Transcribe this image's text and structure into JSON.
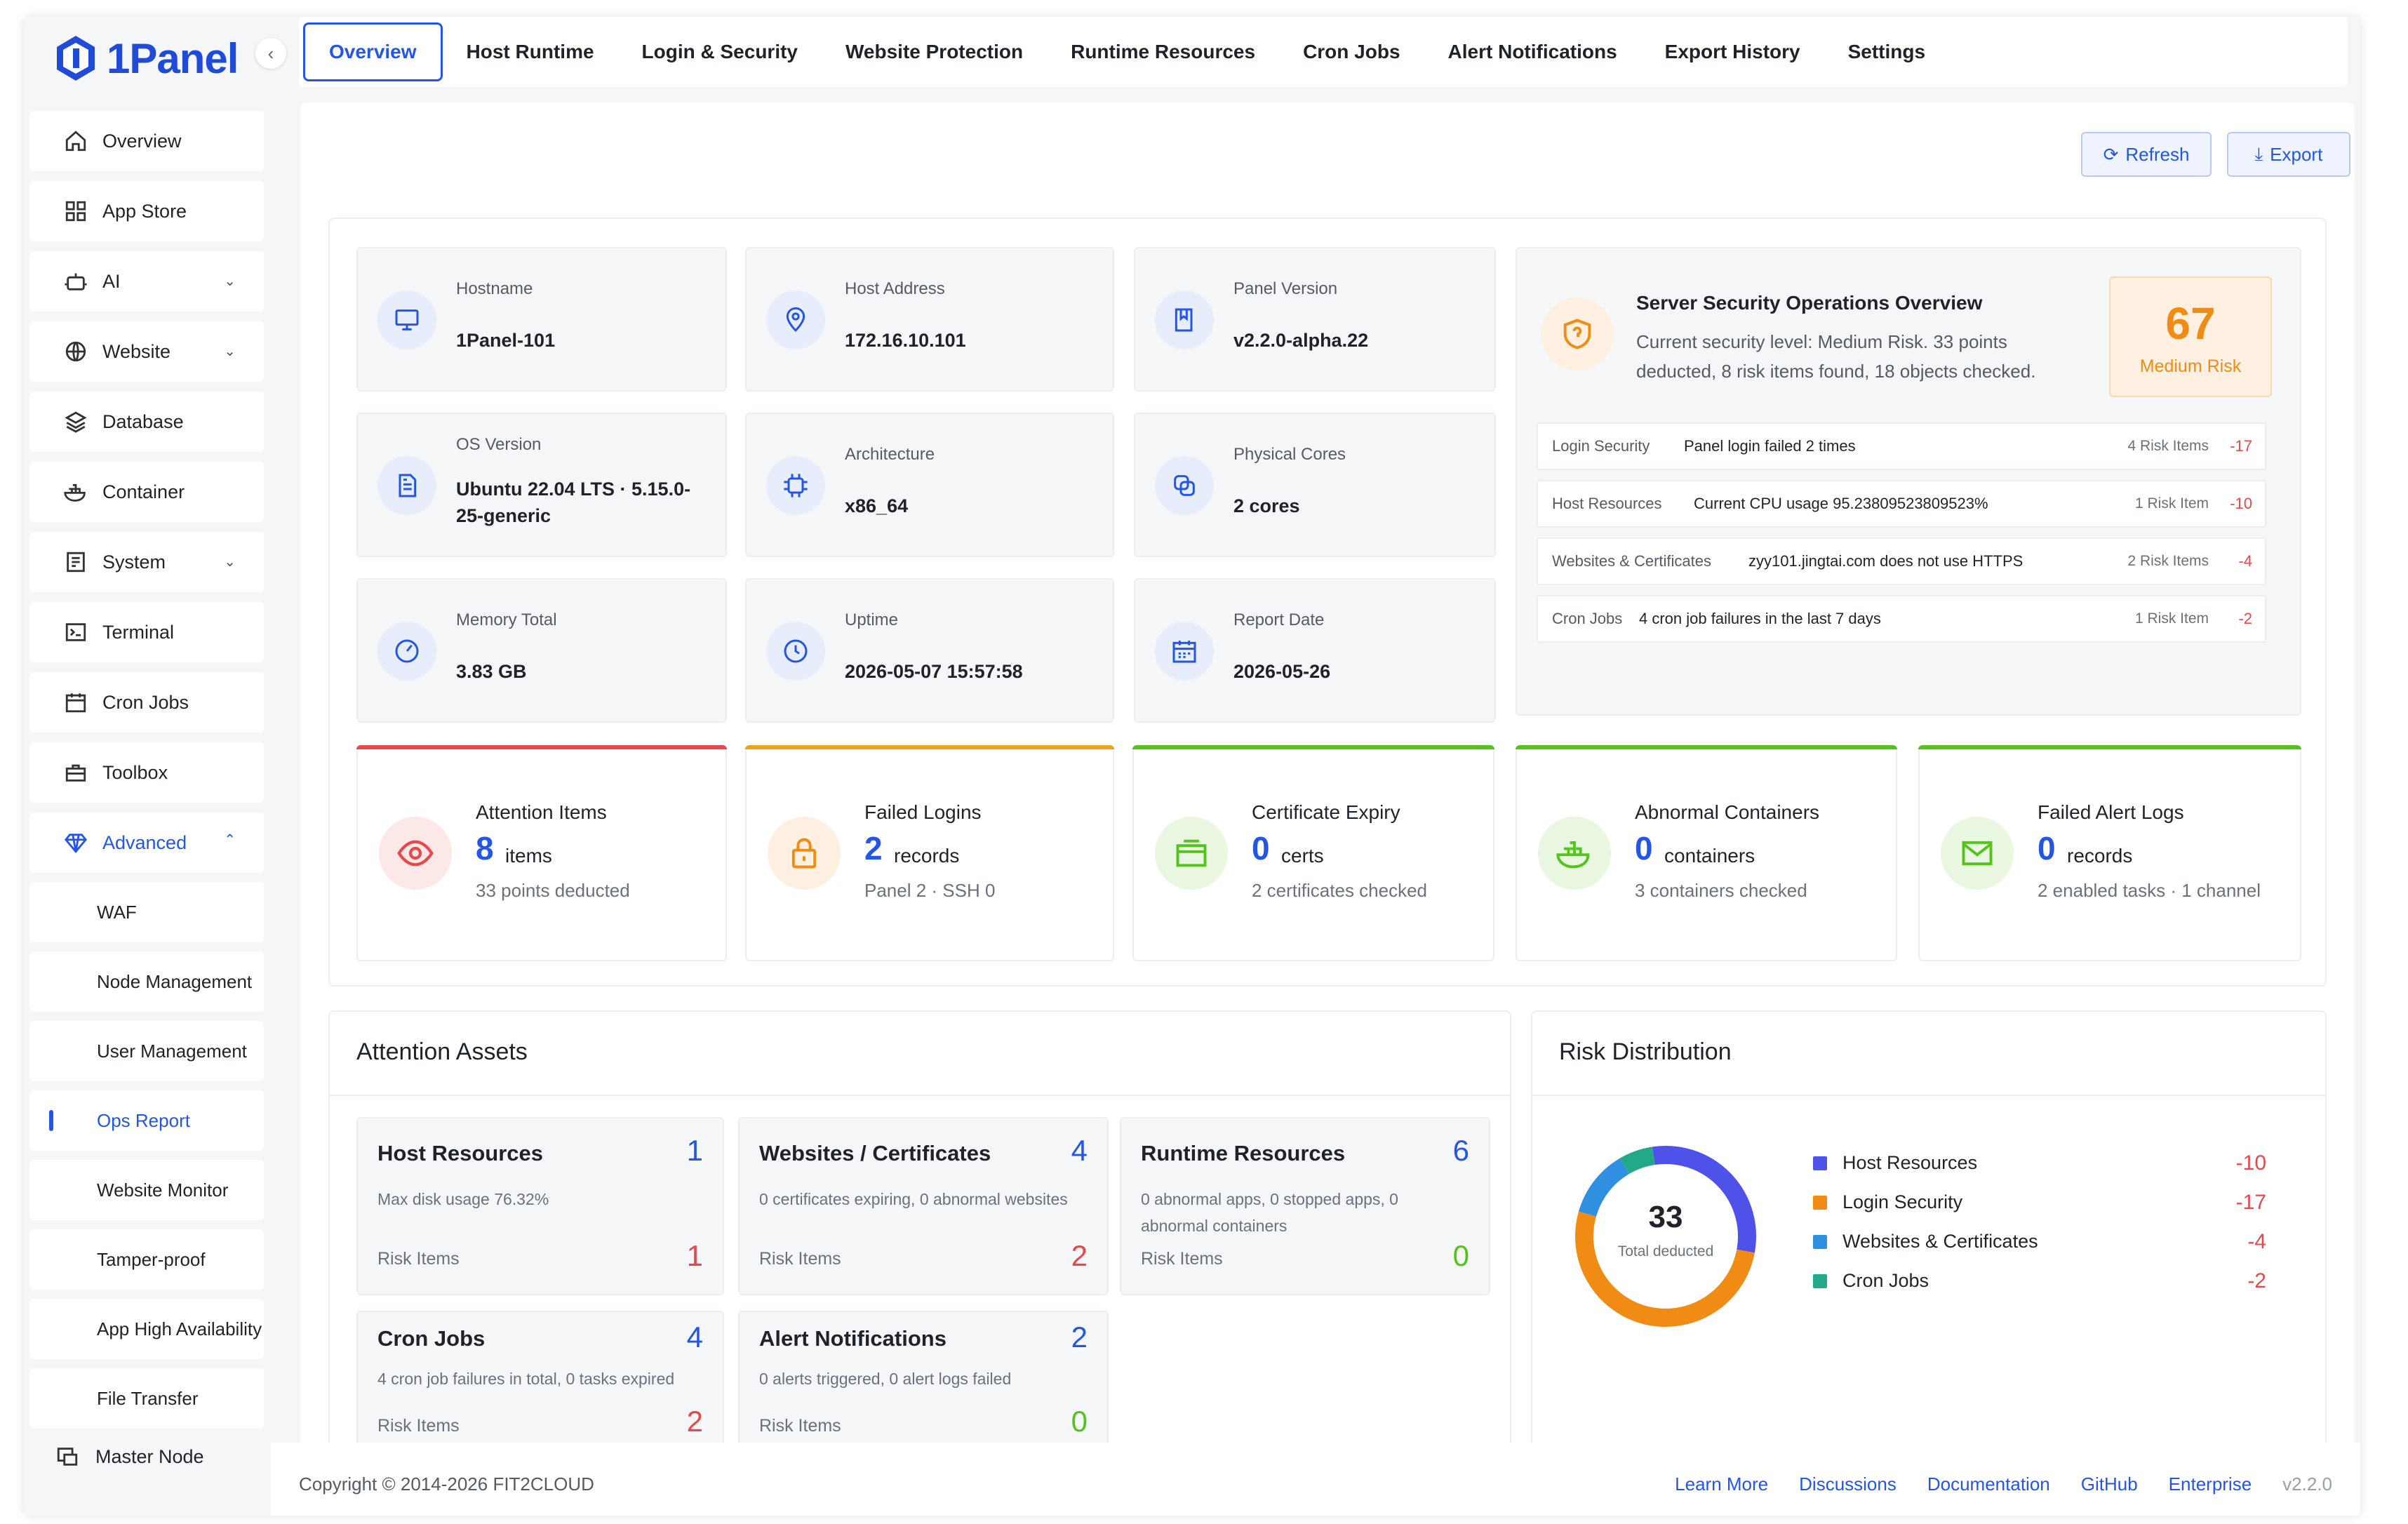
{
  "app": {
    "name": "1Panel"
  },
  "sidebar": {
    "items": [
      {
        "label": "Overview",
        "icon": "home-icon"
      },
      {
        "label": "App Store",
        "icon": "grid-icon"
      },
      {
        "label": "AI",
        "icon": "robot-icon"
      },
      {
        "label": "Website",
        "icon": "globe-icon"
      },
      {
        "label": "Database",
        "icon": "layers-icon"
      },
      {
        "label": "Container",
        "icon": "docker-icon"
      },
      {
        "label": "System",
        "icon": "server-icon"
      },
      {
        "label": "Terminal",
        "icon": "terminal-icon"
      },
      {
        "label": "Cron Jobs",
        "icon": "calendar-icon"
      },
      {
        "label": "Toolbox",
        "icon": "toolbox-icon"
      },
      {
        "label": "Advanced",
        "icon": "diamond-icon"
      }
    ],
    "subitems": [
      "WAF",
      "Node Management",
      "User Management",
      "Ops Report",
      "Website Monitor",
      "Tamper-proof",
      "App High Availability",
      "File Transfer"
    ],
    "master_node": "Master Node"
  },
  "tabs": [
    "Overview",
    "Host Runtime",
    "Login & Security",
    "Website Protection",
    "Runtime Resources",
    "Cron Jobs",
    "Alert Notifications",
    "Export History",
    "Settings"
  ],
  "actions": {
    "refresh": "Refresh",
    "export": "Export"
  },
  "info": [
    {
      "label": "Hostname",
      "value": "1Panel-101"
    },
    {
      "label": "Host Address",
      "value": "172.16.10.101"
    },
    {
      "label": "Panel Version",
      "value": "v2.2.0-alpha.22"
    },
    {
      "label": "OS Version",
      "value_line1": "Ubuntu 22.04 LTS · 5.15.0-",
      "value_line2": "25-generic"
    },
    {
      "label": "Architecture",
      "value": "x86_64"
    },
    {
      "label": "Physical Cores",
      "value": "2 cores"
    },
    {
      "label": "Memory Total",
      "value": "3.83 GB"
    },
    {
      "label": "Uptime",
      "value": "2026-05-07 15:57:58"
    },
    {
      "label": "Report Date",
      "value": "2026-05-26"
    }
  ],
  "security": {
    "title": "Server Security Operations Overview",
    "desc_line1": "Current security level: Medium Risk. 33 points",
    "desc_line2": "deducted, 8 risk items found, 18 objects checked.",
    "score": "67",
    "level": "Medium Risk",
    "rows": [
      {
        "category": "Login Security",
        "desc": "Panel login failed 2 times",
        "count": "4 Risk Items",
        "points": "-17"
      },
      {
        "category": "Host Resources",
        "desc": "Current CPU usage 95.23809523809523%",
        "count": "1 Risk Item",
        "points": "-10"
      },
      {
        "category": "Websites & Certificates",
        "desc": "zyy101.jingtai.com does not use HTTPS",
        "count": "2 Risk Items",
        "points": "-4"
      },
      {
        "category": "Cron Jobs",
        "desc": "4 cron job failures in the last 7 days",
        "count": "1 Risk Item",
        "points": "-2"
      }
    ]
  },
  "stats": [
    {
      "title": "Attention Items",
      "num": "8",
      "unit": "items",
      "sub": "33 points deducted",
      "accent": "#e5484d"
    },
    {
      "title": "Failed Logins",
      "num": "2",
      "unit": "records",
      "sub": "Panel  2 · SSH 0",
      "accent": "#f0a020"
    },
    {
      "title": "Certificate Expiry",
      "num": "0",
      "unit": "certs",
      "sub": "2 certificates checked",
      "accent": "#52c41a"
    },
    {
      "title": "Abnormal Containers",
      "num": "0",
      "unit": "containers",
      "sub": "3 containers checked",
      "accent": "#52c41a"
    },
    {
      "title": "Failed Alert Logs",
      "num": "0",
      "unit": "records",
      "sub": "2 enabled tasks · 1 channel",
      "accent": "#52c41a"
    }
  ],
  "assets": {
    "title": "Attention Assets",
    "risk_label": "Risk Items",
    "cards": [
      {
        "title": "Host Resources",
        "count": "1",
        "desc": "Max disk usage 76.32%",
        "risk": "1"
      },
      {
        "title": "Websites / Certificates",
        "count": "4",
        "desc": "0 certificates expiring, 0 abnormal websites",
        "risk": "2"
      },
      {
        "title": "Runtime Resources",
        "count": "6",
        "desc": "0 abnormal apps, 0 stopped apps, 0 abnormal containers",
        "risk": "0"
      },
      {
        "title": "Cron Jobs",
        "count": "4",
        "desc": "4 cron job failures in total, 0 tasks expired",
        "risk": "2"
      },
      {
        "title": "Alert Notifications",
        "count": "2",
        "desc": "0 alerts triggered, 0 alert logs failed",
        "risk": "0"
      }
    ]
  },
  "risk_distribution": {
    "title": "Risk Distribution",
    "center_value": "33",
    "center_label": "Total deducted"
  },
  "chart_data": {
    "type": "pie",
    "categories": [
      "Host Resources",
      "Login Security",
      "Websites & Certificates",
      "Cron Jobs"
    ],
    "values": [
      10,
      17,
      4,
      2
    ],
    "labels": [
      "-10",
      "-17",
      "-4",
      "-2"
    ],
    "colors": [
      "#4f52e8",
      "#f08c14",
      "#2f8fe0",
      "#23a98a"
    ],
    "legend": "right"
  },
  "footer": {
    "copyright": "Copyright © 2014-2026 FIT2CLOUD",
    "links": [
      "Learn More",
      "Discussions",
      "Documentation",
      "GitHub",
      "Enterprise"
    ],
    "version": "v2.2.0"
  },
  "colors": {
    "primary": "#2456e5",
    "danger": "#e5484d",
    "warning": "#f08c14",
    "success": "#52c41a"
  }
}
